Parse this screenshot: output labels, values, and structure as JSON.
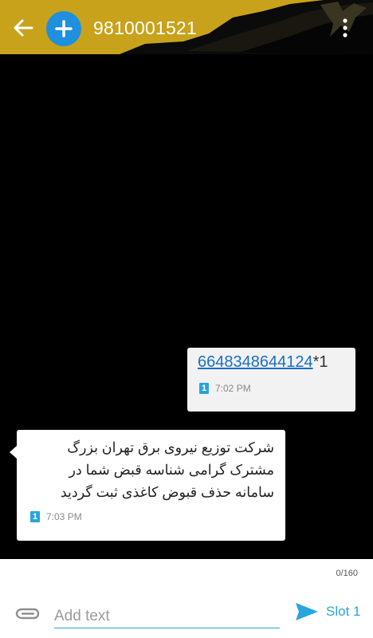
{
  "header": {
    "title": "9810001521",
    "background_color": "#c9a21b",
    "icons": [
      "arrow-left-icon",
      "plus-icon",
      "more-vert-icon"
    ]
  },
  "messages": [
    {
      "direction": "outgoing",
      "prefix": "1",
      "code": "6648348644124",
      "suffix": "*",
      "slot": "1",
      "time": "7:02 PM"
    },
    {
      "direction": "incoming",
      "lines": [
        "شرکت توزیع نیروی برق تهران بزرگ",
        "مشترک گرامی شناسه قبض شما در",
        "سامانه حذف قبوض کاغذی ثبت گردید"
      ],
      "slot": "1",
      "time": "7:03 PM"
    }
  ],
  "composer": {
    "counter": "0/160",
    "placeholder": "Add text",
    "send_label": "Slot 1",
    "accent_color": "#28a4de",
    "icons": [
      "paperclip-icon",
      "send-icon"
    ]
  }
}
